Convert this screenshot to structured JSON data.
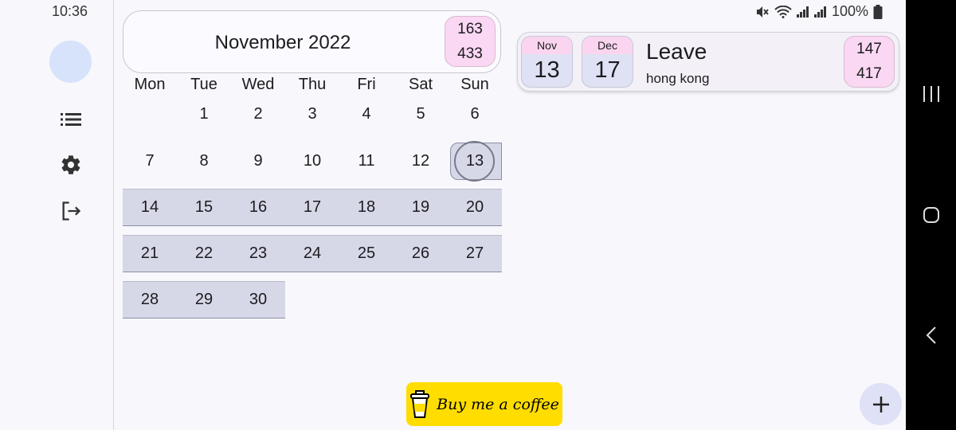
{
  "status": {
    "time": "10:36",
    "battery": "100%"
  },
  "rail": {
    "items": [
      {
        "icon": "list-icon"
      },
      {
        "icon": "gear-icon"
      },
      {
        "icon": "logout-icon"
      }
    ]
  },
  "calendar": {
    "title": "November 2022",
    "counter_top": "163",
    "counter_bottom": "433",
    "weekdays": [
      "Mon",
      "Tue",
      "Wed",
      "Thu",
      "Fri",
      "Sat",
      "Sun"
    ],
    "weeks": [
      [
        "",
        "1",
        "2",
        "3",
        "4",
        "5",
        "6"
      ],
      [
        "7",
        "8",
        "9",
        "10",
        "11",
        "12",
        "13"
      ],
      [
        "14",
        "15",
        "16",
        "17",
        "18",
        "19",
        "20"
      ],
      [
        "21",
        "22",
        "23",
        "24",
        "25",
        "26",
        "27"
      ],
      [
        "28",
        "29",
        "30",
        "",
        "",
        "",
        ""
      ]
    ],
    "today": "13"
  },
  "event": {
    "start_month": "Nov",
    "start_day": "13",
    "end_month": "Dec",
    "end_day": "17",
    "title": "Leave",
    "location": "hong kong",
    "counter_top": "147",
    "counter_bottom": "417"
  },
  "coffee_label": "Buy me a coffee",
  "colors": {
    "selected_week": "#d6d8e8",
    "counter_bg": "#fad7f2",
    "coffee_bg": "#ffdd00"
  }
}
